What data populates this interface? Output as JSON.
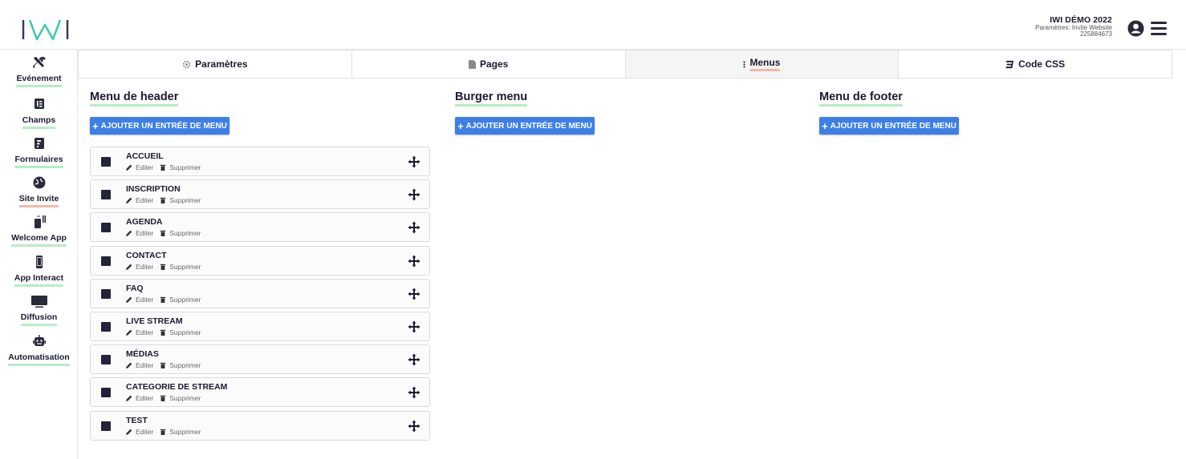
{
  "header": {
    "event_title": "IWI DÉMO 2022",
    "event_subtitle": "Paramètres: Invite Website",
    "event_id": "225884673"
  },
  "sidebar": {
    "items": [
      {
        "label": "Evénement",
        "icon": "tools-icon"
      },
      {
        "label": "Champs",
        "icon": "fields-icon"
      },
      {
        "label": "Formulaires",
        "icon": "form-icon"
      },
      {
        "label": "Site Invite",
        "icon": "globe-icon",
        "active": true
      },
      {
        "label": "Welcome App",
        "icon": "welcome-app-icon"
      },
      {
        "label": "App Interact",
        "icon": "phone-icon"
      },
      {
        "label": "Diffusion",
        "icon": "monitor-icon"
      },
      {
        "label": "Automatisation",
        "icon": "robot-icon"
      }
    ]
  },
  "tabs": [
    {
      "label": "Paramètres",
      "icon": "gear-icon"
    },
    {
      "label": "Pages",
      "icon": "page-icon"
    },
    {
      "label": "Menus",
      "icon": "menu-dots-icon",
      "active": true
    },
    {
      "label": "Code CSS",
      "icon": "css-icon"
    }
  ],
  "columns": {
    "header_menu": {
      "title": "Menu de header",
      "add_label": "AJOUTER UN ENTRÉE DE MENU"
    },
    "burger_menu": {
      "title": "Burger menu",
      "add_label": "AJOUTER UN ENTRÉE DE MENU"
    },
    "footer_menu": {
      "title": "Menu de footer",
      "add_label": "AJOUTER UN ENTRÉE DE MENU"
    }
  },
  "menu_items": [
    {
      "name": "ACCUEIL",
      "edit": "Editer",
      "delete": "Supprimer"
    },
    {
      "name": "INSCRIPTION",
      "edit": "Editer",
      "delete": "Supprimer"
    },
    {
      "name": "AGENDA",
      "edit": "Editer",
      "delete": "Supprimer"
    },
    {
      "name": "CONTACT",
      "edit": "Editer",
      "delete": "Supprimer"
    },
    {
      "name": "FAQ",
      "edit": "Editer",
      "delete": "Supprimer"
    },
    {
      "name": "LIVE STREAM",
      "edit": "Editer",
      "delete": "Supprimer"
    },
    {
      "name": "MÉDIAS",
      "edit": "Editer",
      "delete": "Supprimer"
    },
    {
      "name": "CATEGORIE DE STREAM",
      "edit": "Editer",
      "delete": "Supprimer"
    },
    {
      "name": "TEST",
      "edit": "Editer",
      "delete": "Supprimer"
    }
  ],
  "colors": {
    "primary_button": "#3d7fe6",
    "underline_green": "#b8ecc4",
    "underline_active": "#f7b9a0",
    "text_dark": "#1a1a2e"
  }
}
